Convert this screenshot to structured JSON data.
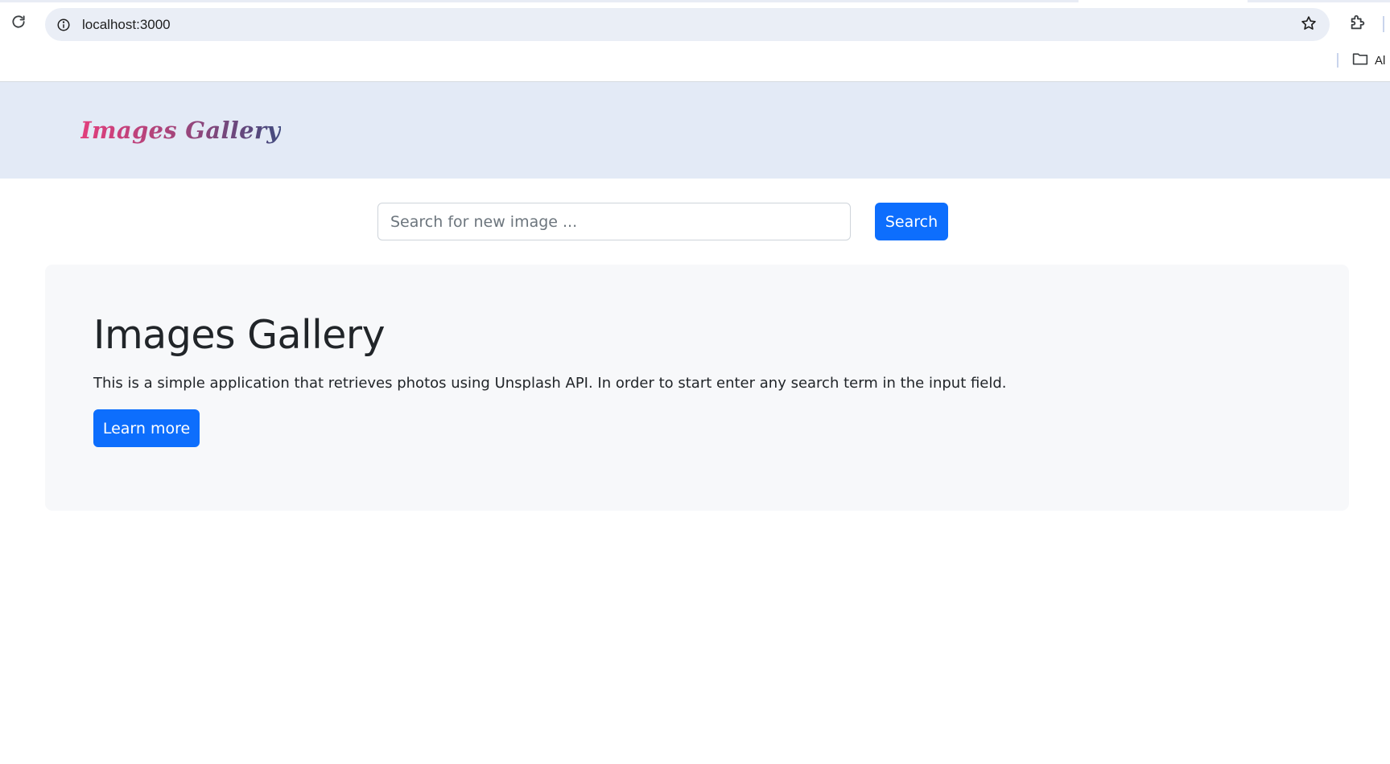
{
  "browser": {
    "url": "localhost:3000",
    "bookmark_folder_label": "Al"
  },
  "navbar": {
    "brand": "Images Gallery"
  },
  "search": {
    "placeholder": "Search for new image ...",
    "value": "",
    "button_label": "Search"
  },
  "jumbotron": {
    "title": "Images Gallery",
    "description": "This is a simple application that retrieves photos using Unsplash API. In order to start enter any search term in the input field.",
    "button_label": "Learn more"
  },
  "colors": {
    "navbar_bg": "#e3eaf6",
    "primary": "#0d6efd",
    "jumbotron_bg": "#f7f8fa",
    "brand_gradient_start": "#e23e7c",
    "brand_gradient_end": "#414a7e"
  },
  "icons": {
    "reload": "reload-icon",
    "info": "info-icon",
    "star": "star-icon",
    "extensions": "puzzle-icon",
    "folder": "folder-icon"
  }
}
